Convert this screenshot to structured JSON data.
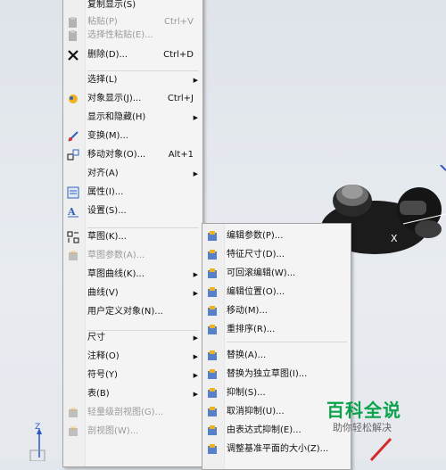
{
  "menu": {
    "items": [
      {
        "label": "复制显示(S)",
        "shortcut": "",
        "icon": "copy-display-icon",
        "disabled": false,
        "submenu": false
      },
      {
        "label": "粘贴(P)",
        "shortcut": "Ctrl+V",
        "icon": "paste-icon",
        "disabled": true,
        "submenu": false
      },
      {
        "label": "选择性粘贴(E)...",
        "shortcut": "",
        "icon": "paste-special-icon",
        "disabled": true,
        "submenu": false
      },
      {
        "label": "删除(D)...",
        "shortcut": "Ctrl+D",
        "icon": "delete-x-icon",
        "disabled": false,
        "submenu": false
      },
      {
        "label": "选择(L)",
        "shortcut": "",
        "icon": "",
        "disabled": false,
        "submenu": true
      },
      {
        "label": "对象显示(J)...",
        "shortcut": "Ctrl+J",
        "icon": "object-display-icon",
        "disabled": false,
        "submenu": false
      },
      {
        "label": "显示和隐藏(H)",
        "shortcut": "",
        "icon": "",
        "disabled": false,
        "submenu": true
      },
      {
        "label": "变换(M)...",
        "shortcut": "",
        "icon": "transform-icon",
        "disabled": false,
        "submenu": false
      },
      {
        "label": "移动对象(O)...",
        "shortcut": "Alt+1",
        "icon": "move-object-icon",
        "disabled": false,
        "submenu": false
      },
      {
        "label": "对齐(A)",
        "shortcut": "",
        "icon": "",
        "disabled": false,
        "submenu": true
      },
      {
        "label": "属性(I)...",
        "shortcut": "",
        "icon": "properties-icon",
        "disabled": false,
        "submenu": false
      },
      {
        "label": "设置(S)...",
        "shortcut": "",
        "icon": "settings-icon",
        "disabled": false,
        "submenu": false
      },
      {
        "label": "草图(K)...",
        "shortcut": "",
        "icon": "sketch-icon",
        "disabled": false,
        "submenu": false
      },
      {
        "label": "草图参数(A)...",
        "shortcut": "",
        "icon": "sketch-params-icon",
        "disabled": true,
        "submenu": false
      },
      {
        "label": "草图曲线(K)...",
        "shortcut": "",
        "icon": "",
        "disabled": false,
        "submenu": true
      },
      {
        "label": "曲线(V)",
        "shortcut": "",
        "icon": "",
        "disabled": false,
        "submenu": true
      },
      {
        "label": "用户定义对象(N)...",
        "shortcut": "",
        "icon": "",
        "disabled": false,
        "submenu": false
      },
      {
        "label": "尺寸",
        "shortcut": "",
        "icon": "",
        "disabled": false,
        "submenu": true
      },
      {
        "label": "注释(O)",
        "shortcut": "",
        "icon": "",
        "disabled": false,
        "submenu": true
      },
      {
        "label": "符号(Y)",
        "shortcut": "",
        "icon": "",
        "disabled": false,
        "submenu": true
      },
      {
        "label": "表(B)",
        "shortcut": "",
        "icon": "",
        "disabled": false,
        "submenu": true
      },
      {
        "label": "轻量级剖视图(G)...",
        "shortcut": "",
        "icon": "lightweight-section-icon",
        "disabled": true,
        "submenu": false
      },
      {
        "label": "剖视图(W)...",
        "shortcut": "",
        "icon": "section-view-icon",
        "disabled": true,
        "submenu": false
      }
    ]
  },
  "submenu": {
    "items": [
      {
        "label": "编辑参数(P)...",
        "icon": "edit-params-icon"
      },
      {
        "label": "特征尺寸(D)...",
        "icon": "feature-dimension-icon"
      },
      {
        "label": "可回滚编辑(W)...",
        "icon": "rollback-edit-icon"
      },
      {
        "label": "编辑位置(O)...",
        "icon": "edit-position-icon"
      },
      {
        "label": "移动(M)...",
        "icon": "move-icon"
      },
      {
        "label": "重排序(R)...",
        "icon": "reorder-icon"
      },
      {
        "label": "替换(A)...",
        "icon": "replace-icon"
      },
      {
        "label": "替换为独立草图(I)...",
        "icon": "replace-sketch-icon"
      },
      {
        "label": "抑制(S)...",
        "icon": "suppress-icon"
      },
      {
        "label": "取消抑制(U)...",
        "icon": "unsuppress-icon"
      },
      {
        "label": "由表达式抑制(E)...",
        "icon": "suppress-by-expression-icon"
      },
      {
        "label": "调整基准平面的大小(Z)...",
        "icon": "resize-datum-plane-icon"
      }
    ]
  },
  "viewport": {
    "x_label": "X",
    "z_label": "Z"
  },
  "watermark": {
    "main": "百科全说",
    "sub": "助你轻松解决"
  }
}
